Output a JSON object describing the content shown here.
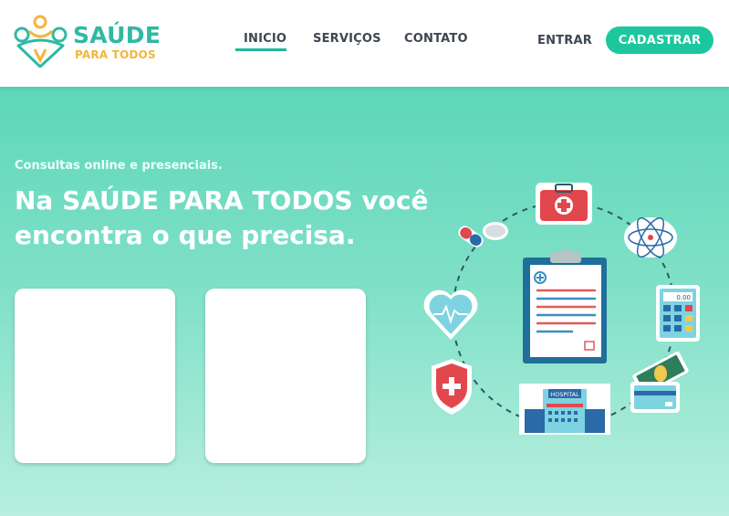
{
  "brand": {
    "name": "SAÚDE",
    "tagline": "PARA TODOS",
    "primary_color": "#2fb9a3",
    "accent_color": "#f2b63a"
  },
  "nav": {
    "items": [
      {
        "label": "INICIO",
        "active": true
      },
      {
        "label": "SERVIÇOS",
        "active": false
      },
      {
        "label": "CONTATO",
        "active": false
      }
    ],
    "login_label": "ENTRAR",
    "signup_label": "CADASTRAR"
  },
  "hero": {
    "subtitle": "Consultas online e presenciais.",
    "headline": "Na SAÚDE PARA TODOS você encontra o que precisa.",
    "cards": [
      {
        "kind": "blank-card"
      },
      {
        "kind": "blank-card"
      }
    ]
  },
  "illustration": {
    "hospital_sign": "HOSPITAL",
    "calculator_display": "0.00",
    "icons": [
      "first-aid-kit-icon",
      "pills-icon",
      "atom-icon",
      "heartbeat-icon",
      "calculator-icon",
      "shield-cross-icon",
      "hospital-icon",
      "money-card-icon",
      "clipboard-icon"
    ]
  }
}
